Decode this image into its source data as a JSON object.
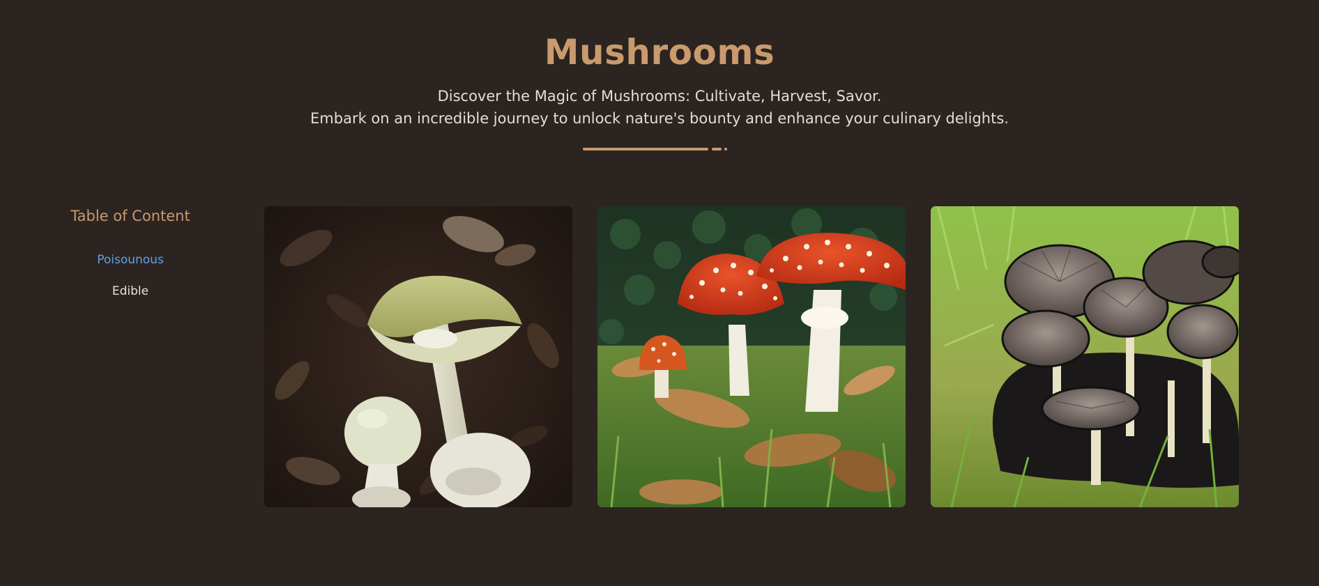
{
  "header": {
    "title": "Mushrooms",
    "tagline_1": "Discover the Magic of Mushrooms: Cultivate, Harvest, Savor.",
    "tagline_2": "Embark on an incredible journey to unlock nature's bounty and enhance your culinary delights."
  },
  "toc": {
    "title": "Table of Content",
    "items": [
      {
        "label": "Poisounous",
        "active": true
      },
      {
        "label": "Edible",
        "active": false
      }
    ]
  },
  "colors": {
    "background": "#2c2420",
    "accent": "#c99a6e",
    "link_active": "#5ea2ee",
    "text": "#e4ddd5"
  },
  "gallery": {
    "images": [
      {
        "subject": "pale green-capped white mushroom on dark leaf litter"
      },
      {
        "subject": "red fly agaric mushrooms with white spots on grass"
      },
      {
        "subject": "cluster of dark grey ink cap mushrooms in grass"
      }
    ]
  }
}
